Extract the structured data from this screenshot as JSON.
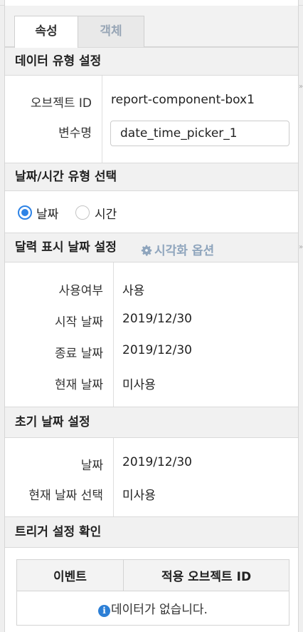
{
  "tabs": [
    {
      "label": "속성",
      "active": true
    },
    {
      "label": "객체",
      "active": false
    }
  ],
  "data_type_section": {
    "title": "데이터 유형 설정",
    "object_id_label": "오브젝트 ID",
    "object_id_value": "report-component-box1",
    "variable_label": "변수명",
    "variable_value": "date_time_picker_1"
  },
  "datetime_type_section": {
    "title": "날짜/시간 유형 선택",
    "options": [
      {
        "label": "날짜",
        "selected": true
      },
      {
        "label": "시간",
        "selected": false
      }
    ]
  },
  "calendar_section": {
    "title": "달력 표시 날짜 설정",
    "viz_option_label": "시각화 옵션",
    "rows": [
      {
        "label": "사용여부",
        "value": "사용"
      },
      {
        "label": "시작 날짜",
        "value": "2019/12/30"
      },
      {
        "label": "종료 날짜",
        "value": "2019/12/30"
      },
      {
        "label": "현재 날짜",
        "value": "미사용"
      }
    ]
  },
  "initial_date_section": {
    "title": "초기 날짜 설정",
    "rows": [
      {
        "label": "날짜",
        "value": "2019/12/30"
      },
      {
        "label": "현재 날짜 선택",
        "value": "미사용"
      }
    ]
  },
  "trigger_section": {
    "title": "트리거 설정 확인",
    "columns": [
      "이벤트",
      "적용 오브젝트 ID"
    ],
    "empty_message": "데이터가 없습니다."
  },
  "colors": {
    "accent": "#2d83e6",
    "inactive_tab_text": "#98a6b6",
    "section_bg": "#f1f1f1"
  }
}
